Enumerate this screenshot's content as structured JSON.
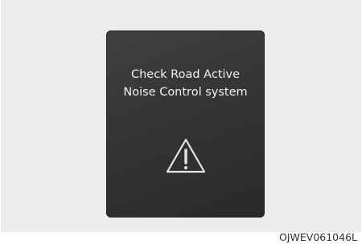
{
  "display": {
    "message_line1": "Check Road Active",
    "message_line2": "Noise Control system",
    "icon": "warning-triangle-icon",
    "background_color": "#333333",
    "text_color": "#f0f0f0"
  },
  "figure_code": "OJWEV061046L"
}
